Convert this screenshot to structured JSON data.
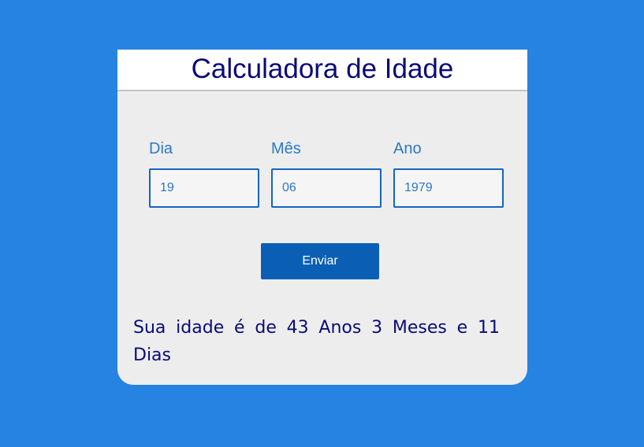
{
  "page": {
    "title": "Calculadora de Idade"
  },
  "form": {
    "day": {
      "label": "Dia",
      "value": "19"
    },
    "month": {
      "label": "Mês",
      "value": "06"
    },
    "year": {
      "label": "Ano",
      "value": "1979"
    },
    "submit_label": "Enviar"
  },
  "result": {
    "text": "Sua idade é de 43 Anos 3 Meses e 11 Dias"
  },
  "colors": {
    "background": "#2683e1",
    "card": "#ededed",
    "title": "#0a0a78",
    "label": "#2b78c8",
    "button": "#0a5fb5"
  }
}
